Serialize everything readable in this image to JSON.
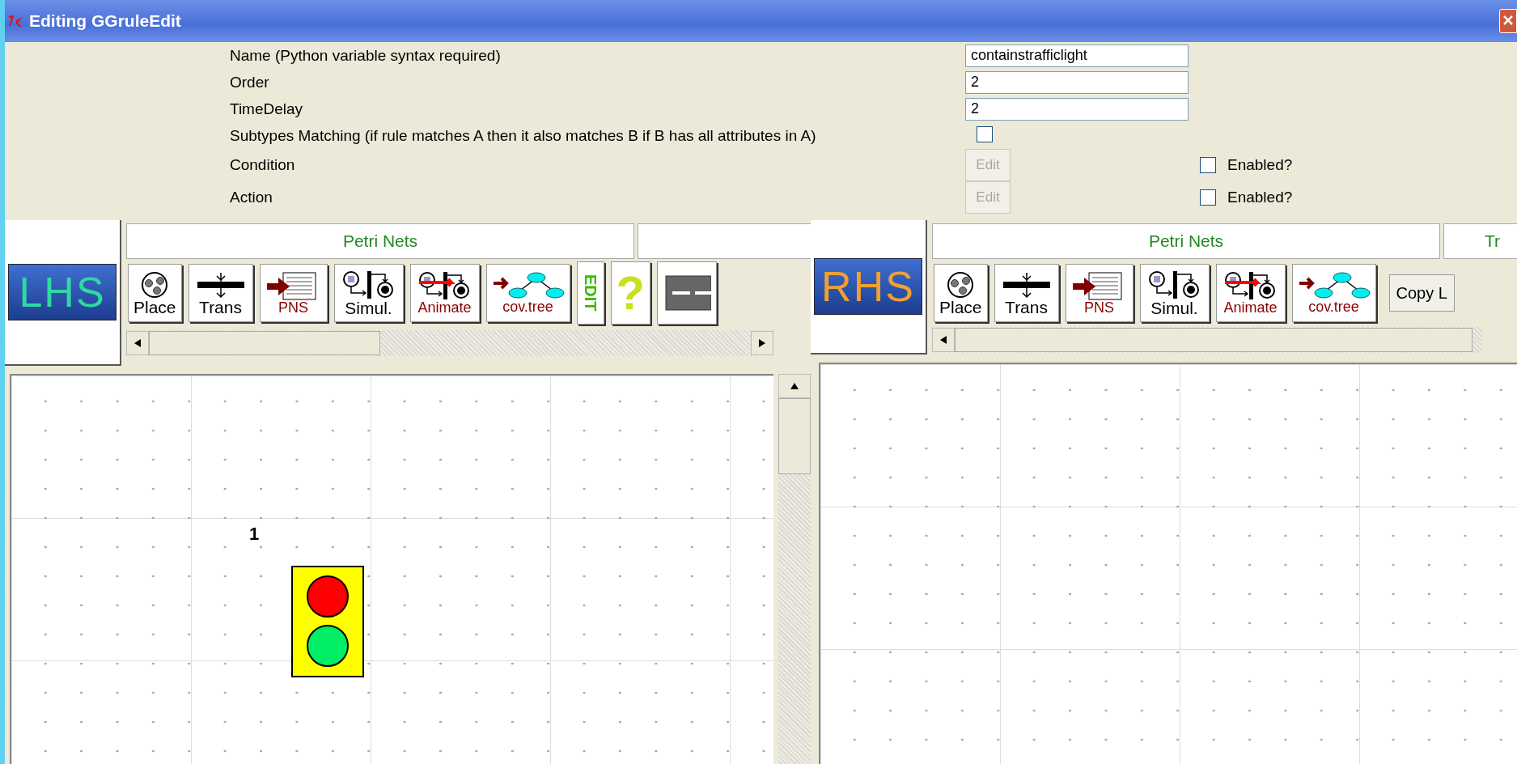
{
  "window": {
    "title": "Editing GGruleEdit"
  },
  "fields": [
    {
      "kind": "text",
      "label": "Name (Python variable syntax required)",
      "value": "containstrafficlight"
    },
    {
      "kind": "text",
      "label": "Order",
      "value": "2"
    },
    {
      "kind": "text",
      "label": "TimeDelay",
      "value": "2"
    },
    {
      "kind": "checkbox",
      "label": "Subtypes Matching (if rule matches A then it also matches B if B has all attributes in A)",
      "checked": false
    },
    {
      "kind": "code",
      "label": "Condition",
      "button": "Edit",
      "disabled": true,
      "option": "Enabled?",
      "checked": false
    },
    {
      "kind": "code",
      "label": "Action",
      "button": "Edit",
      "disabled": true,
      "option": "Enabled?",
      "checked": false
    }
  ],
  "panels": [
    {
      "logo": "LHS",
      "tabs": [
        "Petri Nets"
      ],
      "tools": [
        {
          "kind": "place",
          "label": "Place"
        },
        {
          "kind": "trans",
          "label": "Trans"
        },
        {
          "kind": "pns",
          "label": "PNS"
        },
        {
          "kind": "simul",
          "label": "Simul."
        },
        {
          "kind": "animate",
          "label": "Animate"
        },
        {
          "kind": "covtree",
          "label": "cov.tree"
        },
        {
          "kind": "edit",
          "label": "EDIT"
        },
        {
          "kind": "help",
          "label": "?"
        },
        {
          "kind": "line"
        }
      ],
      "nodes": [
        {
          "kind": "traffic_light",
          "label": "1"
        }
      ]
    },
    {
      "logo": "RHS",
      "tabs": [
        "Petri Nets",
        "Tr"
      ],
      "tools": [
        {
          "kind": "place",
          "label": "Place"
        },
        {
          "kind": "trans",
          "label": "Trans"
        },
        {
          "kind": "pns",
          "label": "PNS"
        },
        {
          "kind": "simul",
          "label": "Simul."
        },
        {
          "kind": "animate",
          "label": "Animate"
        },
        {
          "kind": "covtree",
          "label": "cov.tree"
        },
        {
          "kind": "text",
          "label": "Copy L"
        }
      ]
    }
  ]
}
